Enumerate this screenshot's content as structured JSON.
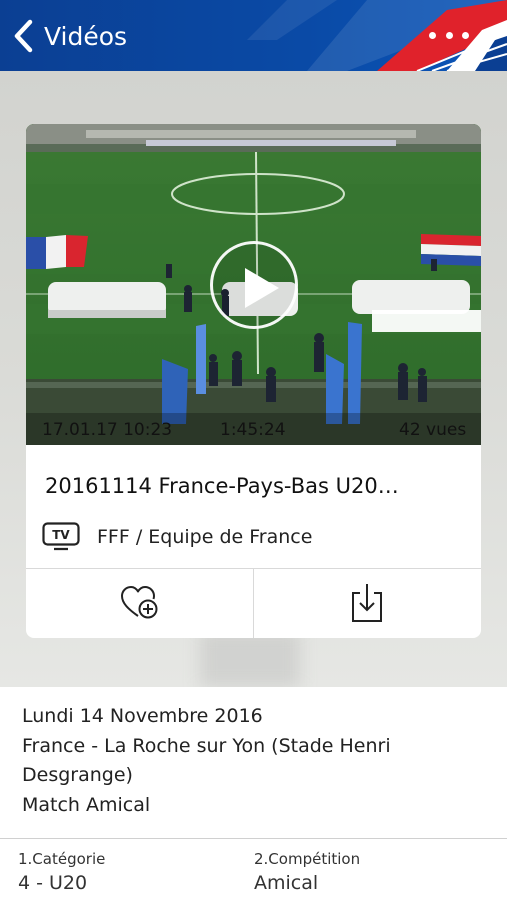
{
  "header": {
    "back_label": "Vidéos",
    "more_icon": "more-horizontal-icon",
    "colors": {
      "primary": "#0b3f93",
      "accent_red": "#e0222b"
    }
  },
  "video": {
    "date_time": "17.01.17 10:23",
    "duration": "1:45:24",
    "views": "42 vues",
    "title": "20161114 France-Pays-Bas U20…",
    "channel": "FFF / Equipe de France",
    "channel_icon": "tv-icon",
    "favorite_icon": "heart-plus-icon",
    "download_icon": "download-icon"
  },
  "details": {
    "date": "Lundi 14 Novembre 2016",
    "location": "France - La Roche sur Yon (Stade Henri Desgrange)",
    "type": "Match Amical"
  },
  "info": {
    "category_label": "1.Catégorie",
    "category_value": "4 - U20",
    "competition_label": "2.Compétition",
    "competition_value": "Amical"
  }
}
